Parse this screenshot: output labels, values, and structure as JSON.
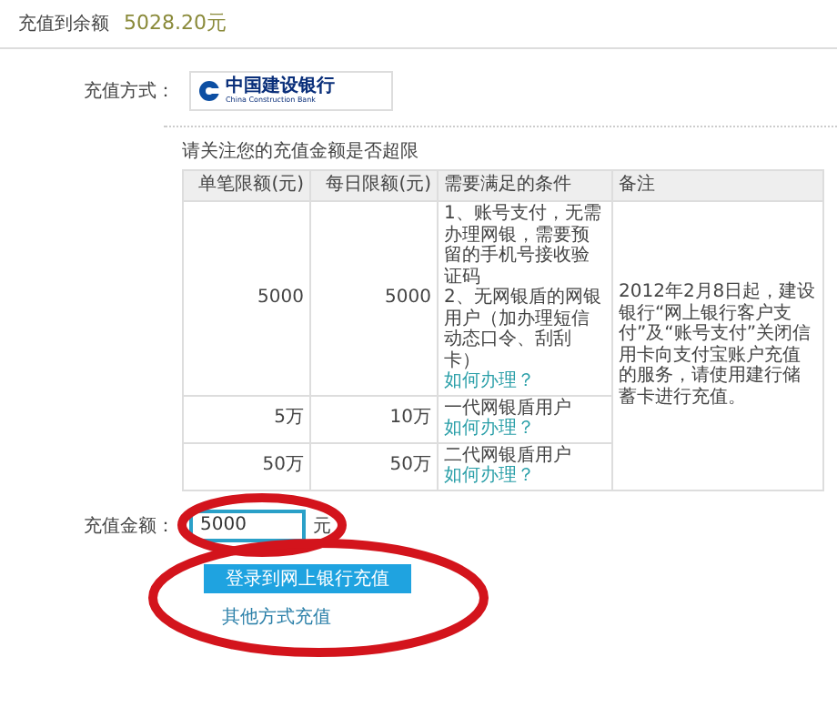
{
  "balance": {
    "label": "充值到余额",
    "amount": "5028.20元"
  },
  "method": {
    "label": "充值方式：",
    "bank_name": "中国建设银行",
    "bank_english": "China Construction Bank"
  },
  "limits": {
    "notice": "请关注您的充值金额是否超限",
    "columns": [
      "单笔限额(元)",
      "每日限额(元)",
      "需要满足的条件",
      "备注"
    ],
    "rows": [
      {
        "single": "5000",
        "daily": "5000",
        "conditions": [
          "1、账号支付，无需办理网银，需要预留的手机号接收验证码",
          "2、无网银盾的网银用户（加办理短信动态口令、刮刮卡）"
        ],
        "link": "如何办理？"
      },
      {
        "single": "5万",
        "daily": "10万",
        "conditions": [
          "一代网银盾用户"
        ],
        "link": "如何办理？"
      },
      {
        "single": "50万",
        "daily": "50万",
        "conditions": [
          "二代网银盾用户"
        ],
        "link": "如何办理？"
      }
    ],
    "remark": "2012年2月8日起，建设银行“网上银行客户支付”及“账号支付”关闭信用卡向支付宝账户充值的服务，请使用建行储蓄卡进行充值。"
  },
  "amount": {
    "label": "充值金额：",
    "value": "5000",
    "unit": "元"
  },
  "submit": {
    "label": "登录到网上银行充值"
  },
  "other_link": "其他方式充值",
  "hand_drawn_circles": [
    {
      "kind": "ellipse"
    },
    {
      "kind": "ellipse"
    }
  ]
}
